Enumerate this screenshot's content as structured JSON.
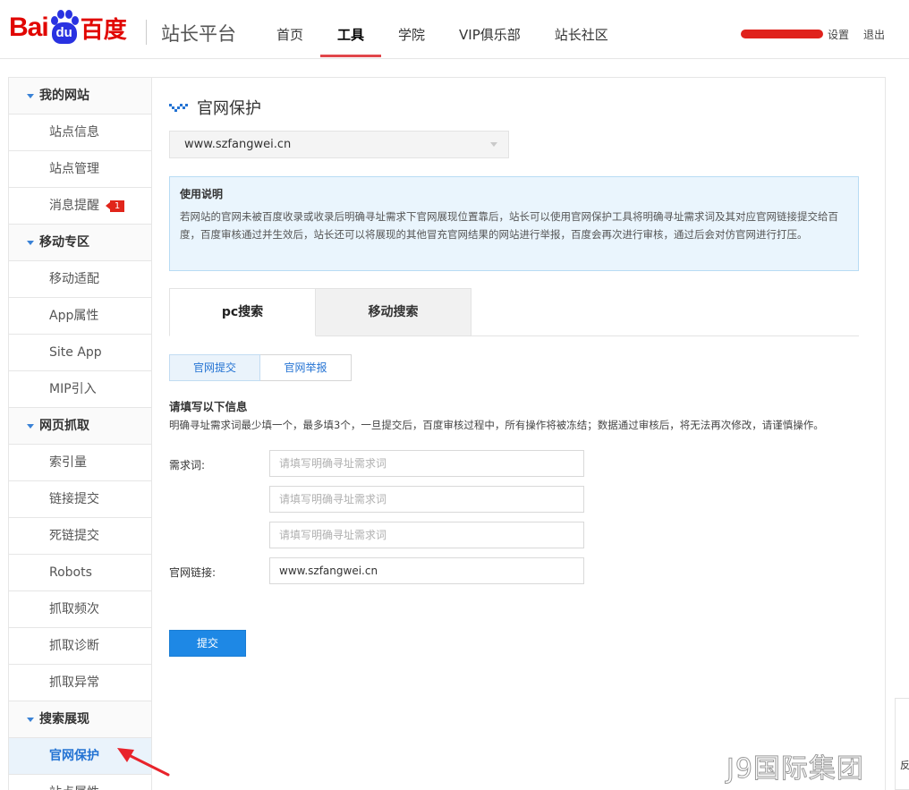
{
  "header": {
    "logo": {
      "part1": "Bai",
      "part2": "du",
      "part3": "百度"
    },
    "platform": "站长平台",
    "nav": [
      {
        "label": "首页",
        "active": false
      },
      {
        "label": "工具",
        "active": true
      },
      {
        "label": "学院",
        "active": false
      },
      {
        "label": "VIP俱乐部",
        "active": false
      },
      {
        "label": "站长社区",
        "active": false
      }
    ],
    "settings": "设置",
    "logout": "退出"
  },
  "sidebar": {
    "groups": [
      {
        "title": "我的网站",
        "items": [
          {
            "label": "站点信息"
          },
          {
            "label": "站点管理"
          },
          {
            "label": "消息提醒",
            "badge": "1"
          }
        ]
      },
      {
        "title": "移动专区",
        "items": [
          {
            "label": "移动适配"
          },
          {
            "label": "App属性"
          },
          {
            "label": "Site App"
          },
          {
            "label": "MIP引入"
          }
        ]
      },
      {
        "title": "网页抓取",
        "items": [
          {
            "label": "索引量"
          },
          {
            "label": "链接提交"
          },
          {
            "label": "死链提交"
          },
          {
            "label": "Robots"
          },
          {
            "label": "抓取频次"
          },
          {
            "label": "抓取诊断"
          },
          {
            "label": "抓取异常"
          }
        ]
      },
      {
        "title": "搜索展现",
        "items": [
          {
            "label": "官网保护",
            "active": true
          },
          {
            "label": "站点属性"
          }
        ]
      }
    ]
  },
  "main": {
    "title": "官网保护",
    "site": "www.szfangwei.cn",
    "info": {
      "title": "使用说明",
      "text": "若网站的官网未被百度收录或收录后明确寻址需求下官网展现位置靠后，站长可以使用官网保护工具将明确寻址需求词及其对应官网链接提交给百度，百度审核通过并生效后，站长还可以将展现的其他冒充官网结果的网站进行举报，百度会再次进行审核，通过后会对仿官网进行打压。"
    },
    "tabs": [
      "pc搜索",
      "移动搜索"
    ],
    "subtabs": [
      "官网提交",
      "官网举报"
    ],
    "form": {
      "heading": "请填写以下信息",
      "description": "明确寻址需求词最少填一个，最多填3个，一旦提交后，百度审核过程中，所有操作将被冻结；数据通过审核后，将无法再次修改，请谨慎操作。",
      "keyword_label": "需求词:",
      "keyword_placeholder": "请填写明确寻址需求词",
      "url_label": "官网链接:",
      "url_value": "www.szfangwei.cn",
      "submit": "提交"
    }
  },
  "widget": {
    "label": "反"
  },
  "watermark": "J9国际集团",
  "colors": {
    "accent": "#1e88e5",
    "brand_red": "#e10602",
    "nav_underline": "#e1474b",
    "badge": "#e1251b",
    "arrow": "#e8232b"
  }
}
